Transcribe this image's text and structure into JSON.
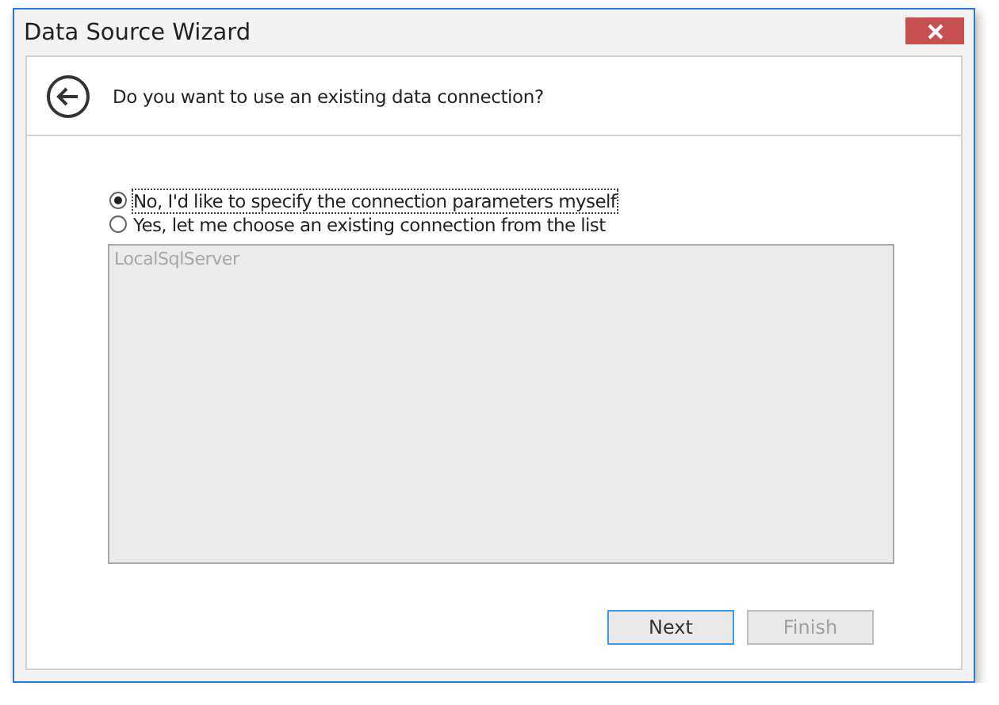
{
  "window": {
    "title": "Data Source Wizard"
  },
  "header": {
    "question": "Do you want to use an existing data connection?"
  },
  "options": [
    {
      "label": "No, I'd like to specify the connection parameters myself",
      "selected": true,
      "focused": true
    },
    {
      "label": "Yes, let me choose an existing connection from the list",
      "selected": false,
      "focused": false
    }
  ],
  "connections_list": {
    "disabled": true,
    "items": [
      "LocalSqlServer"
    ]
  },
  "buttons": [
    {
      "label": "Next",
      "disabled": false,
      "focused": true
    },
    {
      "label": "Finish",
      "disabled": true,
      "focused": false
    }
  ]
}
